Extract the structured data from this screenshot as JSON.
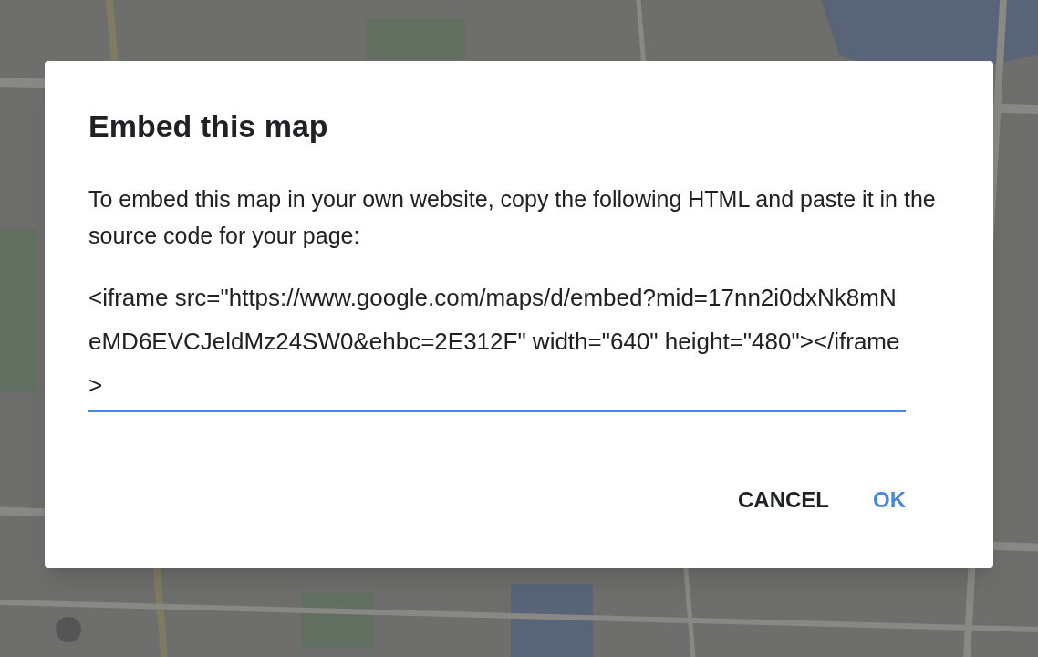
{
  "dialog": {
    "title": "Embed this map",
    "message": "To embed this map in your own website, copy the following HTML and paste it in the source code for your page:",
    "code_field": {
      "value": "<iframe src=\"https://www.google.com/maps/d/embed?mid=17nn2i0dxNk8mNeMD6EVCJeldMz24SW0&ehbc=2E312F\" width=\"640\" height=\"480\"></iframe>",
      "focused": true
    },
    "buttons": [
      {
        "label": "CANCEL",
        "kind": "secondary"
      },
      {
        "label": "OK",
        "kind": "primary"
      }
    ]
  }
}
